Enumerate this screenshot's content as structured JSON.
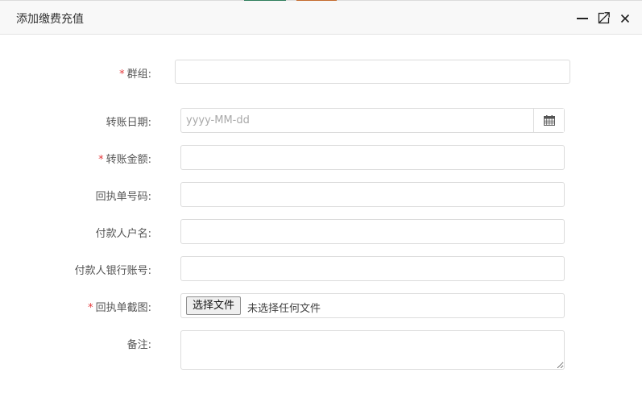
{
  "dialog": {
    "title": "添加缴费充值",
    "controls": {
      "minimize_icon": "minimize-icon",
      "maximize_icon": "maximize-icon",
      "close_icon": "close-icon"
    }
  },
  "form": {
    "group": {
      "label": "群组:",
      "required": "*",
      "value": ""
    },
    "transfer_date": {
      "label": "转账日期:",
      "placeholder": "yyyy-MM-dd",
      "value": "",
      "icon": "calendar-icon"
    },
    "transfer_amount": {
      "label": "转账金额:",
      "required": "*",
      "value": ""
    },
    "receipt_number": {
      "label": "回执单号码:",
      "value": ""
    },
    "payer_name": {
      "label": "付款人户名:",
      "value": ""
    },
    "payer_account": {
      "label": "付款人银行账号:",
      "value": ""
    },
    "receipt_screenshot": {
      "label": "回执单截图:",
      "required": "*",
      "button_label": "选择文件",
      "status": "未选择任何文件"
    },
    "remark": {
      "label": "备注:",
      "value": ""
    }
  },
  "colors": {
    "required": "#e4393c",
    "border": "#dcdcdc",
    "titlebar_bg": "#f8f8f8"
  }
}
